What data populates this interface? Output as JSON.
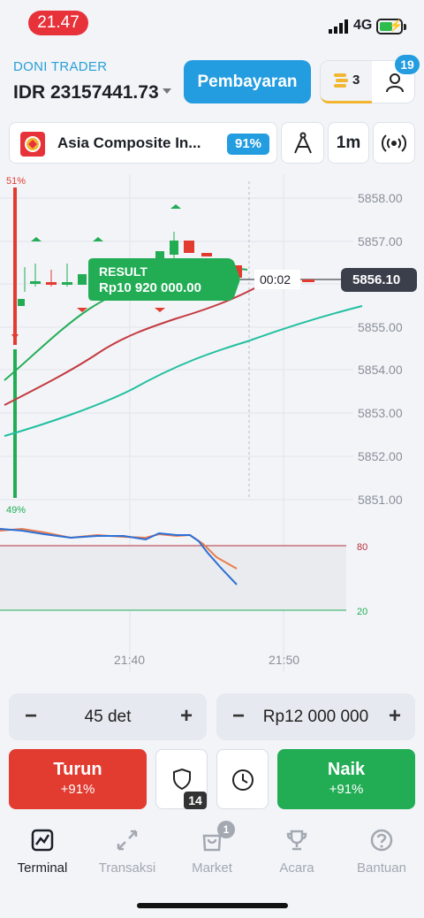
{
  "status_bar": {
    "time": "21.47",
    "network": "4G"
  },
  "account": {
    "name": "DONI TRADER",
    "balance": "IDR 23157441.73"
  },
  "header": {
    "payment_label": "Pembayaran",
    "coins_count": "3",
    "notifications": "19"
  },
  "asset": {
    "name": "Asia Composite In...",
    "payout": "91%"
  },
  "toolbar": {
    "timeframe": "1m"
  },
  "chart": {
    "sentiment_top": "51%",
    "sentiment_bottom": "49%",
    "result_title": "RESULT",
    "result_amount": "Rp10 920 000.00",
    "timer": "00:02",
    "current_price": "5856.10",
    "price_labels": [
      "5858.00",
      "5857.00",
      "5856.00",
      "5855.00",
      "5854.00",
      "5853.00",
      "5852.00",
      "5851.00"
    ],
    "oscillator_levels": [
      "80",
      "20"
    ],
    "time_labels": [
      "21:40",
      "21:50"
    ]
  },
  "controls": {
    "duration": "45 det",
    "amount": "Rp12 000 000"
  },
  "trade": {
    "down_label": "Turun",
    "down_payout": "+91%",
    "up_label": "Naik",
    "up_payout": "+91%",
    "shield_count": "14"
  },
  "nav": {
    "items": [
      {
        "label": "Terminal",
        "icon": "chart-icon",
        "active": true
      },
      {
        "label": "Transaksi",
        "icon": "arrows-icon"
      },
      {
        "label": "Market",
        "icon": "bag-icon",
        "badge": "1"
      },
      {
        "label": "Acara",
        "icon": "trophy-icon"
      },
      {
        "label": "Bantuan",
        "icon": "help-icon"
      }
    ]
  },
  "colors": {
    "accent": "#239ce0",
    "down": "#e23b30",
    "up": "#22ad55",
    "time_pill": "#e8323a"
  }
}
